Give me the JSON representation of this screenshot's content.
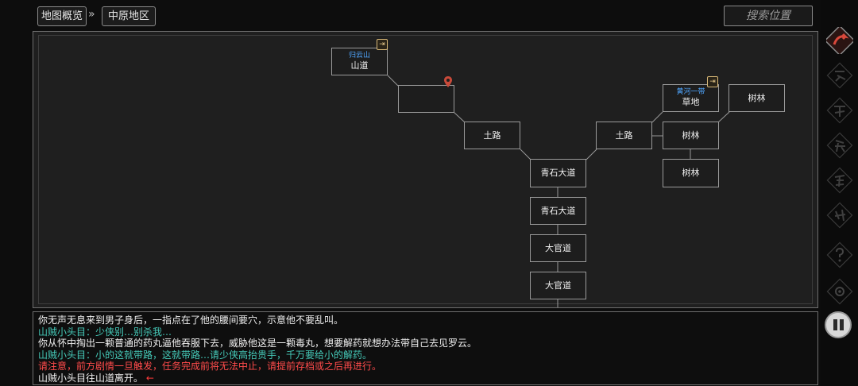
{
  "breadcrumb": {
    "root": "地图概览",
    "separator": "»",
    "current": "中原地区"
  },
  "search": {
    "placeholder": "搜索位置"
  },
  "map": {
    "nodes": {
      "n1": {
        "region": "归云山",
        "name": "山道"
      },
      "n2": {
        "name": ""
      },
      "n3": {
        "name": "土路"
      },
      "n4": {
        "name": "青石大道"
      },
      "n5": {
        "name": "青石大道"
      },
      "n6": {
        "name": "大官道"
      },
      "n7": {
        "name": "大官道"
      },
      "n8": {
        "name": "土路"
      },
      "n9": {
        "region": "黄河一带",
        "name": "草地"
      },
      "n10": {
        "name": "树林"
      },
      "n11": {
        "name": "树林"
      },
      "n12": {
        "name": "树林"
      }
    }
  },
  "log": {
    "lines": [
      {
        "text": "你无声无息来到男子身后，一指点在了他的腰间要穴，示意他不要乱叫。",
        "color": "white"
      },
      {
        "text": "山贼小头目：少侠别…别杀我…",
        "color": "teal"
      },
      {
        "text": "你从怀中掏出一颗普通的药丸逼他吞服下去，威胁他这是一颗毒丸，想要解药就想办法带自己去见罗云。",
        "color": "white"
      },
      {
        "text": "山贼小头目：小的这就带路，这就带路…请少侠高抬贵手，千万要给小的解药。",
        "color": "teal"
      },
      {
        "text": "请注意，前方剧情一旦触发，任务完成前将无法中止，请提前存档或之后再进行。",
        "color": "red"
      },
      {
        "text": "山贼小头目往山道离开。",
        "color": "white",
        "arrow": "←"
      }
    ]
  },
  "sidebar": {
    "buttons": [
      "map-icon",
      "action-icon",
      "skill-icon",
      "item-icon",
      "equip-icon",
      "team-icon",
      "help-icon",
      "settings-icon"
    ]
  },
  "colors": {
    "region_text": "#4fa6ff",
    "teal_text": "#45c9b8",
    "warning_text": "#ff4b4b",
    "accent": "#c94a3a"
  }
}
